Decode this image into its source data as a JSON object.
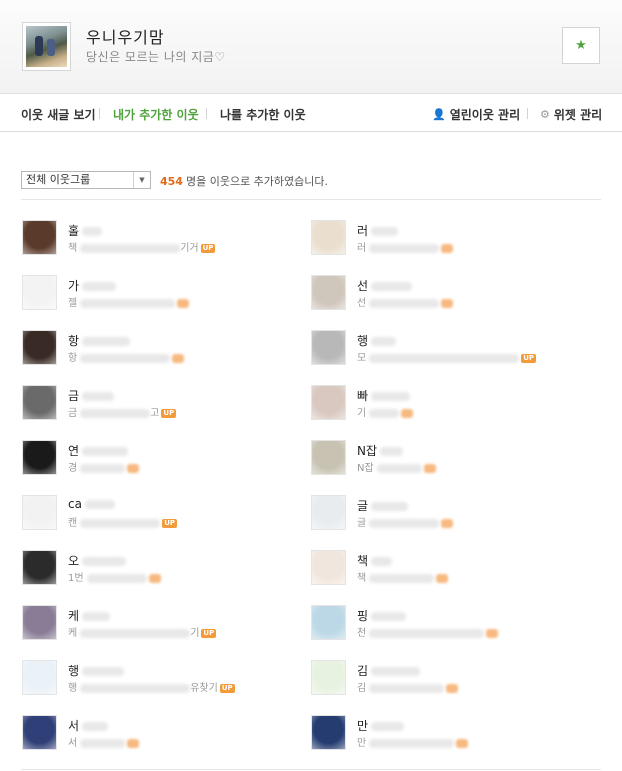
{
  "blog": {
    "title": "우니우기맘",
    "subtitle": "당신은 모르는 나의 지금♡",
    "star_icon": "star-icon"
  },
  "tabs": [
    {
      "label": "이웃 새글 보기",
      "active": false
    },
    {
      "label": "내가 추가한 이웃",
      "active": true
    },
    {
      "label": "나를 추가한 이웃",
      "active": false
    }
  ],
  "tools": {
    "manage_label": "열린이웃 관리",
    "widget_label": "위젯 관리"
  },
  "filter": {
    "selected_group": "전체 이웃그룹",
    "count": "454",
    "count_suffix": "명을 이웃으로 추가하였습니다."
  },
  "neighbors": [
    {
      "name": "홀",
      "desc": "책",
      "desc_tail": "기거",
      "up": true
    },
    {
      "name": "러",
      "desc": "러",
      "desc_tail": "",
      "up": false
    },
    {
      "name": "가",
      "desc": "젤",
      "desc_tail": "",
      "up": false
    },
    {
      "name": "선",
      "desc": "선",
      "desc_tail": "",
      "up": false
    },
    {
      "name": "항",
      "desc": "항",
      "desc_tail": "",
      "up": false
    },
    {
      "name": "행",
      "desc": "모",
      "desc_tail": "",
      "up": true
    },
    {
      "name": "금",
      "desc": "금",
      "desc_tail": "고",
      "up": true
    },
    {
      "name": "빠",
      "desc": "기",
      "desc_tail": "",
      "up": false
    },
    {
      "name": "연",
      "desc": "경",
      "desc_tail": "",
      "up": false
    },
    {
      "name": "N잡",
      "desc": "N잡",
      "desc_tail": "",
      "up": false
    },
    {
      "name": "ca",
      "desc": "캔",
      "desc_tail": "",
      "up": true
    },
    {
      "name": "글",
      "desc": "글",
      "desc_tail": "",
      "up": false
    },
    {
      "name": "오",
      "desc": "1번",
      "desc_tail": "",
      "up": false
    },
    {
      "name": "책",
      "desc": "책",
      "desc_tail": "",
      "up": false
    },
    {
      "name": "케",
      "desc": "케",
      "desc_tail": "기",
      "up": true
    },
    {
      "name": "핑",
      "desc": "천",
      "desc_tail": "",
      "up": false
    },
    {
      "name": "행",
      "desc": "행",
      "desc_tail": "유찾기",
      "up": true
    },
    {
      "name": "김",
      "desc": "김",
      "desc_tail": "",
      "up": false
    },
    {
      "name": "서",
      "desc": "서",
      "desc_tail": "",
      "up": false
    },
    {
      "name": "만",
      "desc": "만",
      "desc_tail": "",
      "up": false
    }
  ],
  "up_badge_label": "UP",
  "avatar_colors": [
    "#5a3a2a",
    "#eadfcf",
    "#f3f3f3",
    "#cfc6bc",
    "#3a2a26",
    "#b8b8b8",
    "#6a6a6a",
    "#d8c8c0",
    "#1a1a1a",
    "#c7c2b2",
    "#f2f2f2",
    "#e9ecef",
    "#2b2b2b",
    "#f1e6dd",
    "#8a7c96",
    "#bcd8e6",
    "#eaf1f7",
    "#e8f2e1",
    "#2f3f78",
    "#243c70"
  ]
}
